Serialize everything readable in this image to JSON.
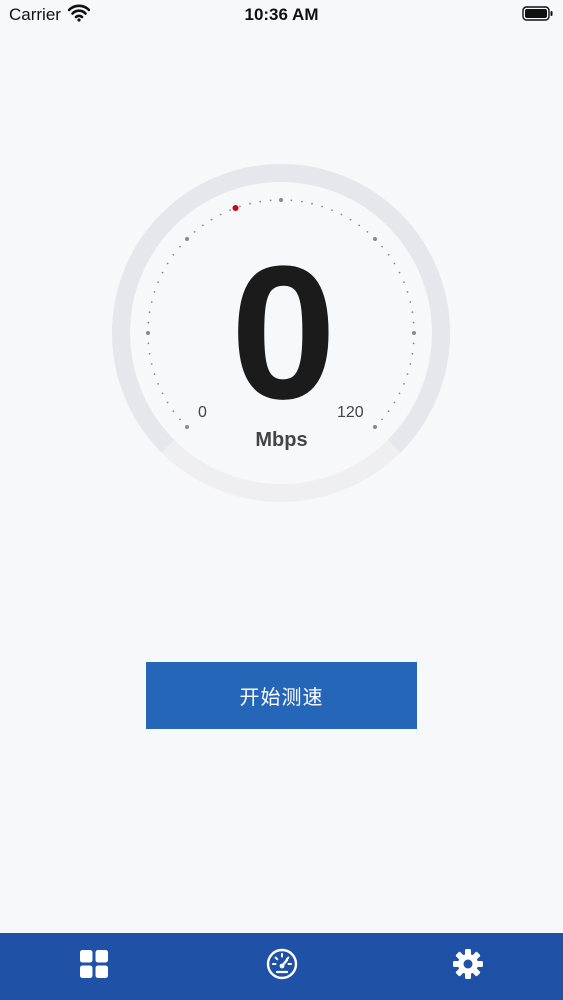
{
  "status_bar": {
    "carrier": "Carrier",
    "time": "10:36 AM",
    "wifi_icon": "wifi-icon",
    "battery_icon": "battery-icon"
  },
  "gauge": {
    "value": "0",
    "unit": "Mbps",
    "scale_min": "0",
    "scale_max": "120",
    "needle_position_fraction": 0.0,
    "colors": {
      "track": "#e6e7ea",
      "ticks": "#8a8a8a",
      "indicator": "#d0021b"
    }
  },
  "start_button": {
    "label": "开始测速",
    "color": "#2566b8"
  },
  "tab_bar": {
    "color": "#1f52a7",
    "tabs": [
      {
        "icon": "grid-icon"
      },
      {
        "icon": "speedometer-icon"
      },
      {
        "icon": "gear-icon"
      }
    ]
  }
}
